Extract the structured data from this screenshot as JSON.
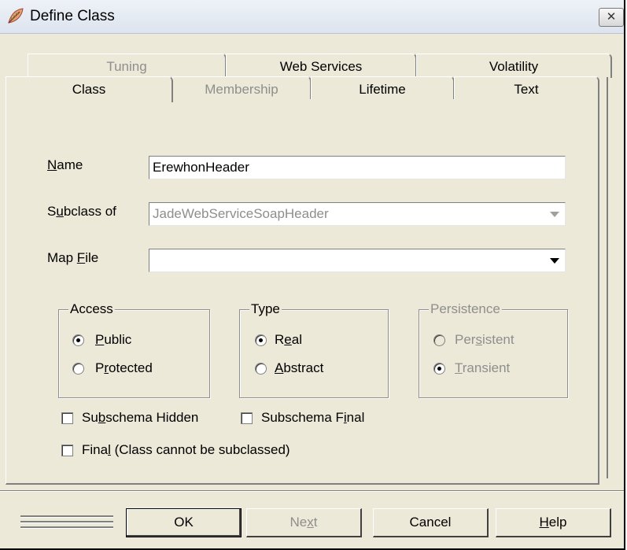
{
  "window": {
    "title": "Define Class",
    "close_label": "✕",
    "icon": "leaf-app-icon"
  },
  "tabs_row_back": [
    {
      "label": "Tuning",
      "enabled": false
    },
    {
      "label": "Web Services",
      "enabled": true
    },
    {
      "label": "Volatility",
      "enabled": true
    }
  ],
  "tabs_row_front": [
    {
      "label": "Class",
      "enabled": true,
      "selected": true
    },
    {
      "label": "Membership",
      "enabled": false
    },
    {
      "label": "Lifetime",
      "enabled": true
    },
    {
      "label": "Text",
      "enabled": true
    }
  ],
  "form": {
    "name": {
      "label_pre": "",
      "label_accel": "N",
      "label_post": "ame",
      "value": "ErewhonHeader"
    },
    "subclass_of": {
      "label_pre": "S",
      "label_accel": "u",
      "label_post": "bclass of",
      "value": "JadeWebServiceSoapHeader",
      "enabled": false
    },
    "map_file": {
      "label_pre": "Map ",
      "label_accel": "F",
      "label_post": "ile",
      "value": ""
    }
  },
  "access": {
    "legend": "Access",
    "options": [
      {
        "pre": "",
        "accel": "P",
        "post": "ublic",
        "selected": true
      },
      {
        "pre": "P",
        "accel": "r",
        "post": "otected",
        "selected": false
      }
    ]
  },
  "type": {
    "legend": "Type",
    "options": [
      {
        "pre": "R",
        "accel": "e",
        "post": "al",
        "selected": true
      },
      {
        "pre": "",
        "accel": "A",
        "post": "bstract",
        "selected": false
      }
    ]
  },
  "persistence": {
    "legend": "Persistence",
    "enabled": false,
    "options": [
      {
        "pre": "Per",
        "accel": "s",
        "post": "istent",
        "selected": false
      },
      {
        "pre": "",
        "accel": "T",
        "post": "ransient",
        "selected": true
      }
    ]
  },
  "checks": {
    "subschema_hidden": {
      "pre": "Su",
      "accel": "b",
      "post": "schema Hidden",
      "checked": false
    },
    "subschema_final": {
      "pre": "Subschema F",
      "accel": "i",
      "post": "nal",
      "checked": false
    },
    "final": {
      "pre": "Fina",
      "accel": "l",
      "post": " (Class cannot be subclassed)",
      "checked": false
    }
  },
  "buttons": {
    "ok": {
      "label": "OK",
      "enabled": true
    },
    "next": {
      "pre": "Ne",
      "accel": "x",
      "post": "t",
      "enabled": false
    },
    "cancel": {
      "label": "Cancel",
      "enabled": true
    },
    "help": {
      "pre": "",
      "accel": "H",
      "post": "elp",
      "enabled": true
    }
  },
  "colors": {
    "face": "#ece9d8",
    "disabled_text": "#8e8e8e",
    "shadow": "#808080"
  }
}
